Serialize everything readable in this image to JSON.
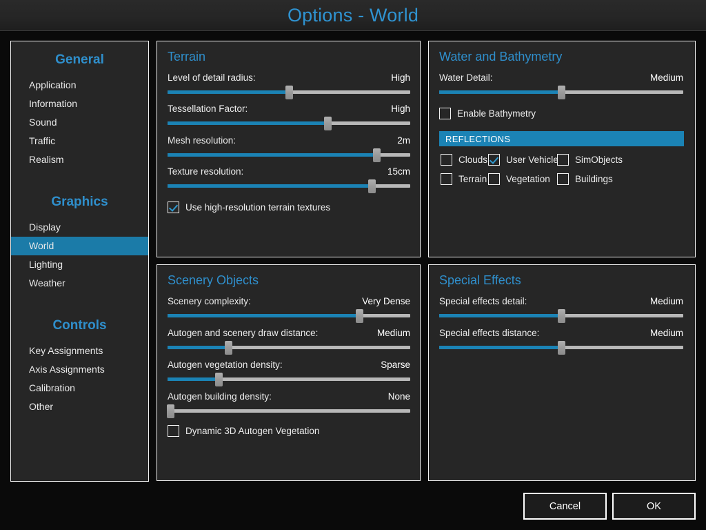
{
  "window": {
    "title": "Options - World"
  },
  "colors": {
    "accent": "#2f8fcc",
    "slider_fill": "#1b83b5",
    "highlight": "#1b7ba8",
    "panel_bg": "#262626",
    "app_bg": "#0a0a0a",
    "text": "#ececec"
  },
  "sidebar": {
    "groups": [
      {
        "title": "General",
        "items": [
          {
            "label": "Application",
            "active": false
          },
          {
            "label": "Information",
            "active": false
          },
          {
            "label": "Sound",
            "active": false
          },
          {
            "label": "Traffic",
            "active": false
          },
          {
            "label": "Realism",
            "active": false
          }
        ]
      },
      {
        "title": "Graphics",
        "items": [
          {
            "label": "Display",
            "active": false
          },
          {
            "label": "World",
            "active": true
          },
          {
            "label": "Lighting",
            "active": false
          },
          {
            "label": "Weather",
            "active": false
          }
        ]
      },
      {
        "title": "Controls",
        "items": [
          {
            "label": "Key Assignments",
            "active": false
          },
          {
            "label": "Axis Assignments",
            "active": false
          },
          {
            "label": "Calibration",
            "active": false
          },
          {
            "label": "Other",
            "active": false
          }
        ]
      }
    ]
  },
  "panels": {
    "terrain": {
      "title": "Terrain",
      "sliders": [
        {
          "label": "Level of detail radius:",
          "value": "High",
          "percent": 50
        },
        {
          "label": "Tessellation Factor:",
          "value": "High",
          "percent": 66
        },
        {
          "label": "Mesh resolution:",
          "value": "2m",
          "percent": 86
        },
        {
          "label": "Texture resolution:",
          "value": "15cm",
          "percent": 84
        }
      ],
      "checkbox": {
        "label": "Use high-resolution terrain textures",
        "checked": true
      }
    },
    "water": {
      "title": "Water and Bathymetry",
      "sliders": [
        {
          "label": "Water Detail:",
          "value": "Medium",
          "percent": 50
        }
      ],
      "checkbox": {
        "label": "Enable Bathymetry",
        "checked": false
      },
      "section": {
        "label": "REFLECTIONS"
      },
      "reflection_options": [
        {
          "label": "Clouds",
          "checked": false
        },
        {
          "label": "User Vehicle",
          "checked": true
        },
        {
          "label": "SimObjects",
          "checked": false
        },
        {
          "label": "Terrain",
          "checked": false
        },
        {
          "label": "Vegetation",
          "checked": false
        },
        {
          "label": "Buildings",
          "checked": false
        }
      ]
    },
    "scenery": {
      "title": "Scenery Objects",
      "sliders": [
        {
          "label": "Scenery complexity:",
          "value": "Very Dense",
          "percent": 79
        },
        {
          "label": "Autogen and scenery draw distance:",
          "value": "Medium",
          "percent": 25
        },
        {
          "label": "Autogen vegetation density:",
          "value": "Sparse",
          "percent": 21
        },
        {
          "label": "Autogen building density:",
          "value": "None",
          "percent": 1
        }
      ],
      "checkbox": {
        "label": "Dynamic 3D Autogen Vegetation",
        "checked": false
      }
    },
    "effects": {
      "title": "Special Effects",
      "sliders": [
        {
          "label": "Special effects detail:",
          "value": "Medium",
          "percent": 50
        },
        {
          "label": "Special effects distance:",
          "value": "Medium",
          "percent": 50
        }
      ]
    }
  },
  "footer": {
    "cancel_label": "Cancel",
    "ok_label": "OK"
  }
}
